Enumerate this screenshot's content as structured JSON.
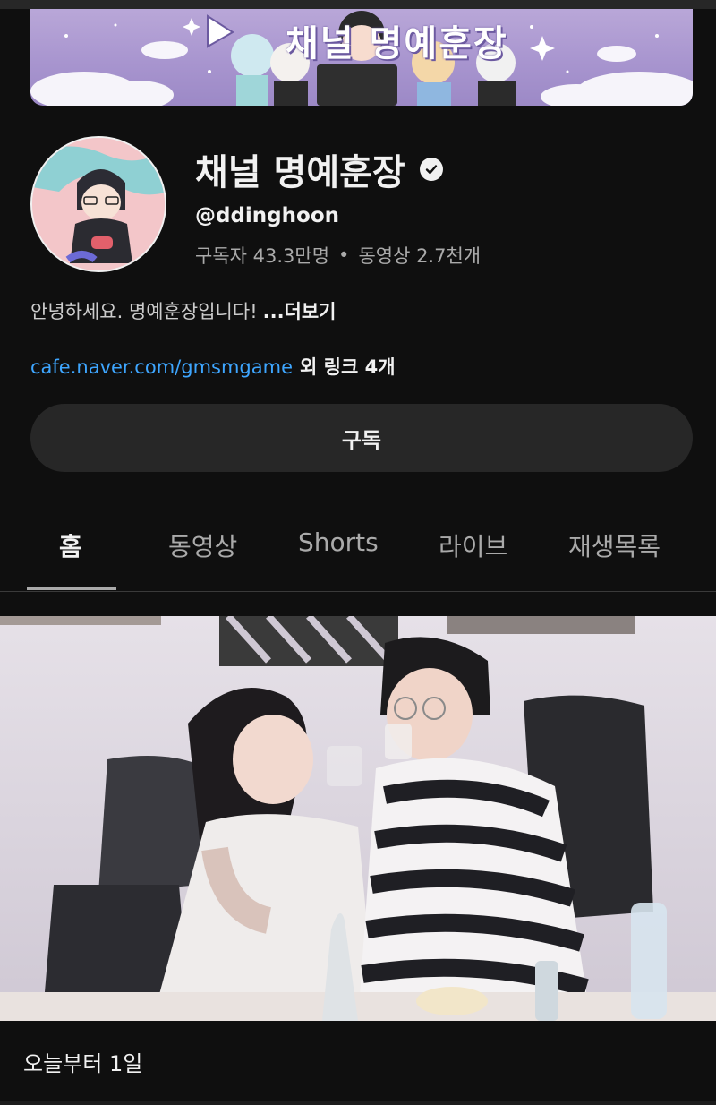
{
  "banner": {
    "text": "채널 명예훈장"
  },
  "channel": {
    "name": "채널 명예훈장",
    "verified_icon": "verified-check-icon",
    "handle": "@ddinghoon",
    "subscribers": "구독자 43.3만명",
    "separator": "•",
    "videos": "동영상 2.7천개",
    "description": "안녕하세요. 명예훈장입니다!",
    "more_label": "...더보기",
    "link_url": "cafe.naver.com/gmsmgame",
    "extra_links": "외 링크 4개",
    "subscribe_label": "구독"
  },
  "tabs": [
    {
      "label": "홈",
      "active": true
    },
    {
      "label": "동영상",
      "active": false
    },
    {
      "label": "Shorts",
      "active": false
    },
    {
      "label": "라이브",
      "active": false
    },
    {
      "label": "재생목록",
      "active": false
    }
  ],
  "featured_video": {
    "title": "오늘부터 1일"
  },
  "colors": {
    "background": "#0f0f0f",
    "link": "#3ea6ff",
    "button_bg": "#272727",
    "secondary_text": "#aaaaaa",
    "banner_purple": "#a895cf"
  }
}
